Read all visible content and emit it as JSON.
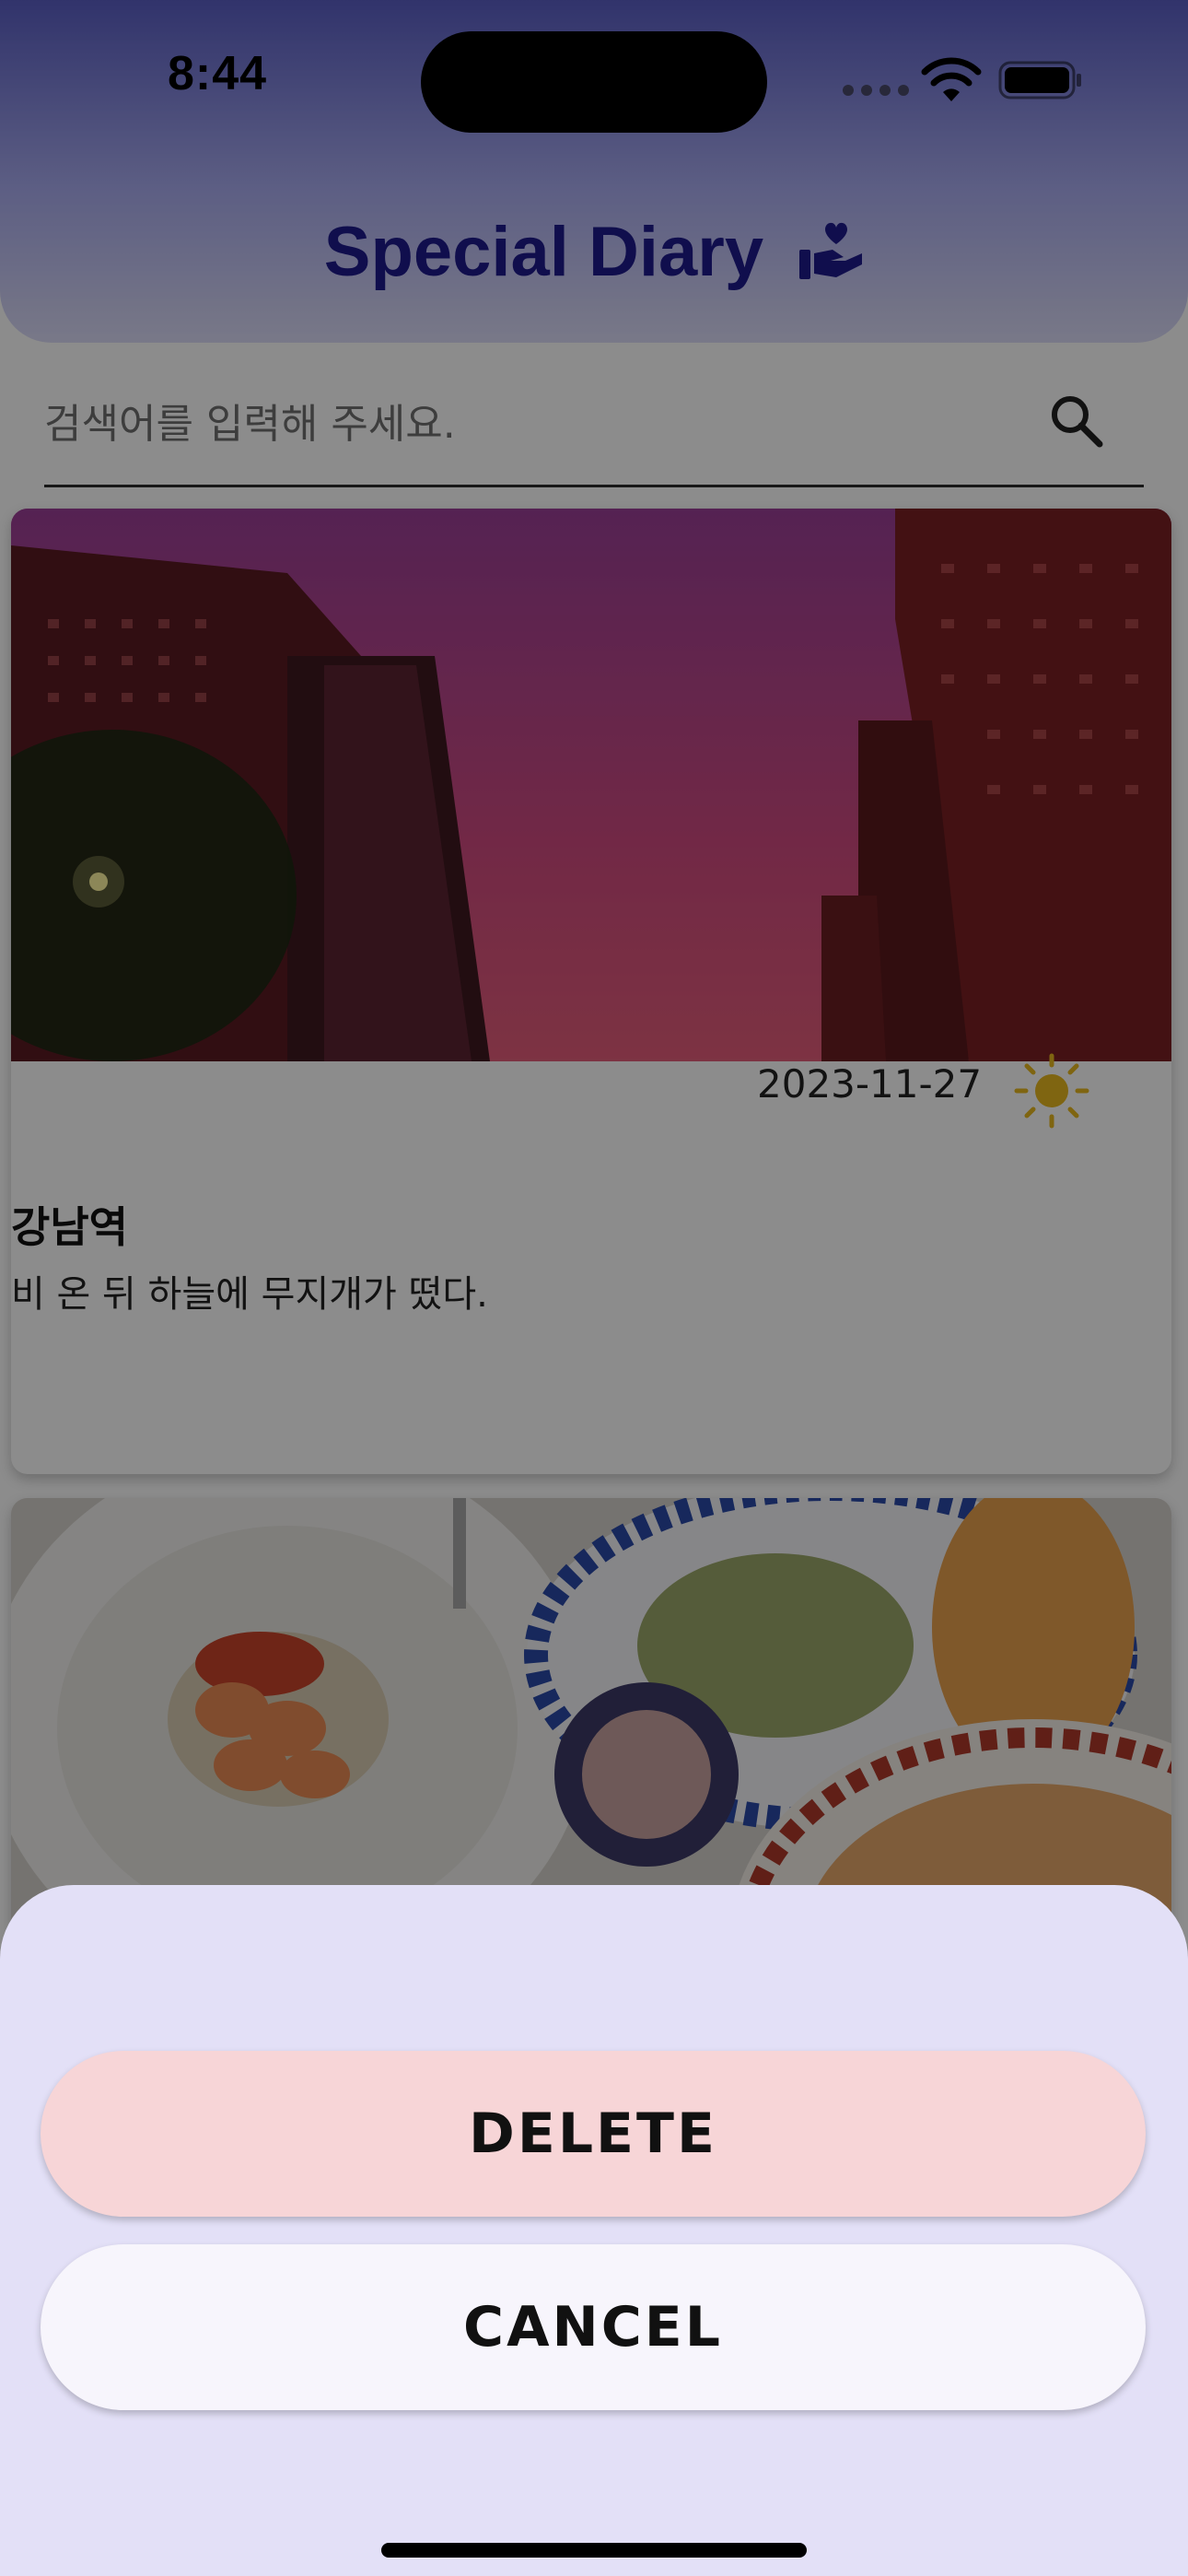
{
  "status_bar": {
    "time": "8:44"
  },
  "header": {
    "title": "Special Diary"
  },
  "search": {
    "placeholder": "검색어를 입력해 주세요."
  },
  "diary_entries": [
    {
      "date": "2023-11-27",
      "weather_icon": "sun-icon",
      "title": "강남역",
      "body": "비 온 뒤 하늘에 무지개가 떴다."
    }
  ],
  "sheet": {
    "delete_label": "DELETE",
    "cancel_label": "CANCEL"
  },
  "colors": {
    "title": "#1e1a8c",
    "header_gradient_top": "#5a5ec4",
    "sheet_background": "#e3e0f7",
    "delete_button": "#f7d5d7",
    "cancel_button": "#f7f5fc",
    "sun": "#e8b820"
  }
}
